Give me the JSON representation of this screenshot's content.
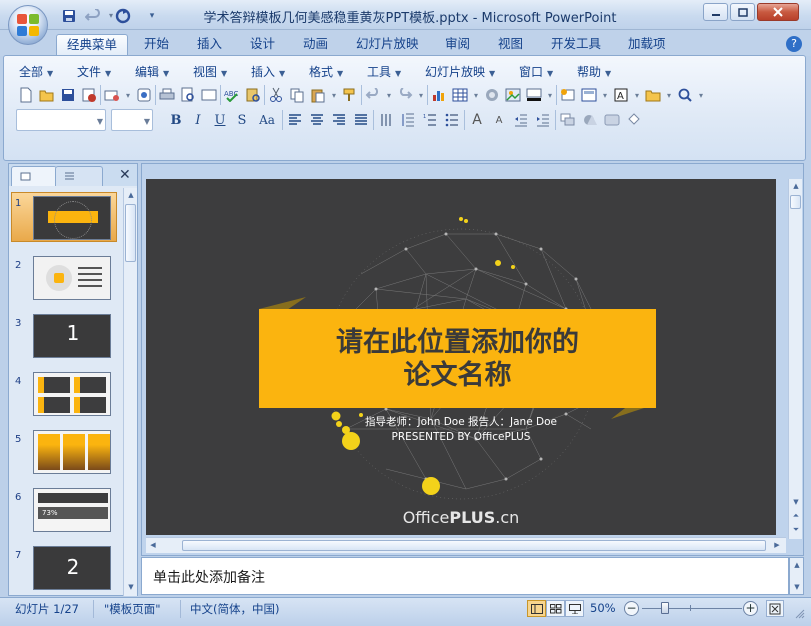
{
  "window": {
    "title": "学术答辩模板几何美感稳重黄灰PPT模板.pptx - Microsoft PowerPoint",
    "qat_overflow": "▾"
  },
  "ribbon_tabs": [
    "经典菜单",
    "开始",
    "插入",
    "设计",
    "动画",
    "幻灯片放映",
    "审阅",
    "视图",
    "开发工具",
    "加载项"
  ],
  "classic_menu": [
    "全部",
    "文件",
    "编辑",
    "视图",
    "插入",
    "格式",
    "工具",
    "幻灯片放映",
    "窗口",
    "帮助"
  ],
  "format_buttons": [
    "B",
    "I",
    "U",
    "S",
    "Aa"
  ],
  "slides": [
    {
      "number": "1",
      "selected": true
    },
    {
      "number": "2",
      "selected": false
    },
    {
      "number": "3",
      "selected": false
    },
    {
      "number": "4",
      "selected": false
    },
    {
      "number": "5",
      "selected": false
    },
    {
      "number": "6",
      "selected": false
    },
    {
      "number": "7",
      "selected": false
    }
  ],
  "slide": {
    "title_line1": "请在此位置添加你的",
    "title_line2": "论文名称",
    "subtitle1": "指导老师：John Doe  报告人：Jane Doe",
    "subtitle2": "PRESENTED BY OfficePLUS",
    "logo_prefix": "Office",
    "logo_bold": "PLUS",
    "logo_suffix": ".cn",
    "bg_color": "#3d3d3e",
    "accent_color": "#fbb40f"
  },
  "thumb_texts": {
    "slide3_number": "1",
    "slide6_banner": "73%",
    "slide7_number": "2"
  },
  "notes": {
    "placeholder": "单击此处添加备注"
  },
  "status": {
    "slide_indicator": "幻灯片 1/27",
    "theme": "\"模板页面\"",
    "language": "中文(简体，中国)",
    "zoom": "50%"
  }
}
